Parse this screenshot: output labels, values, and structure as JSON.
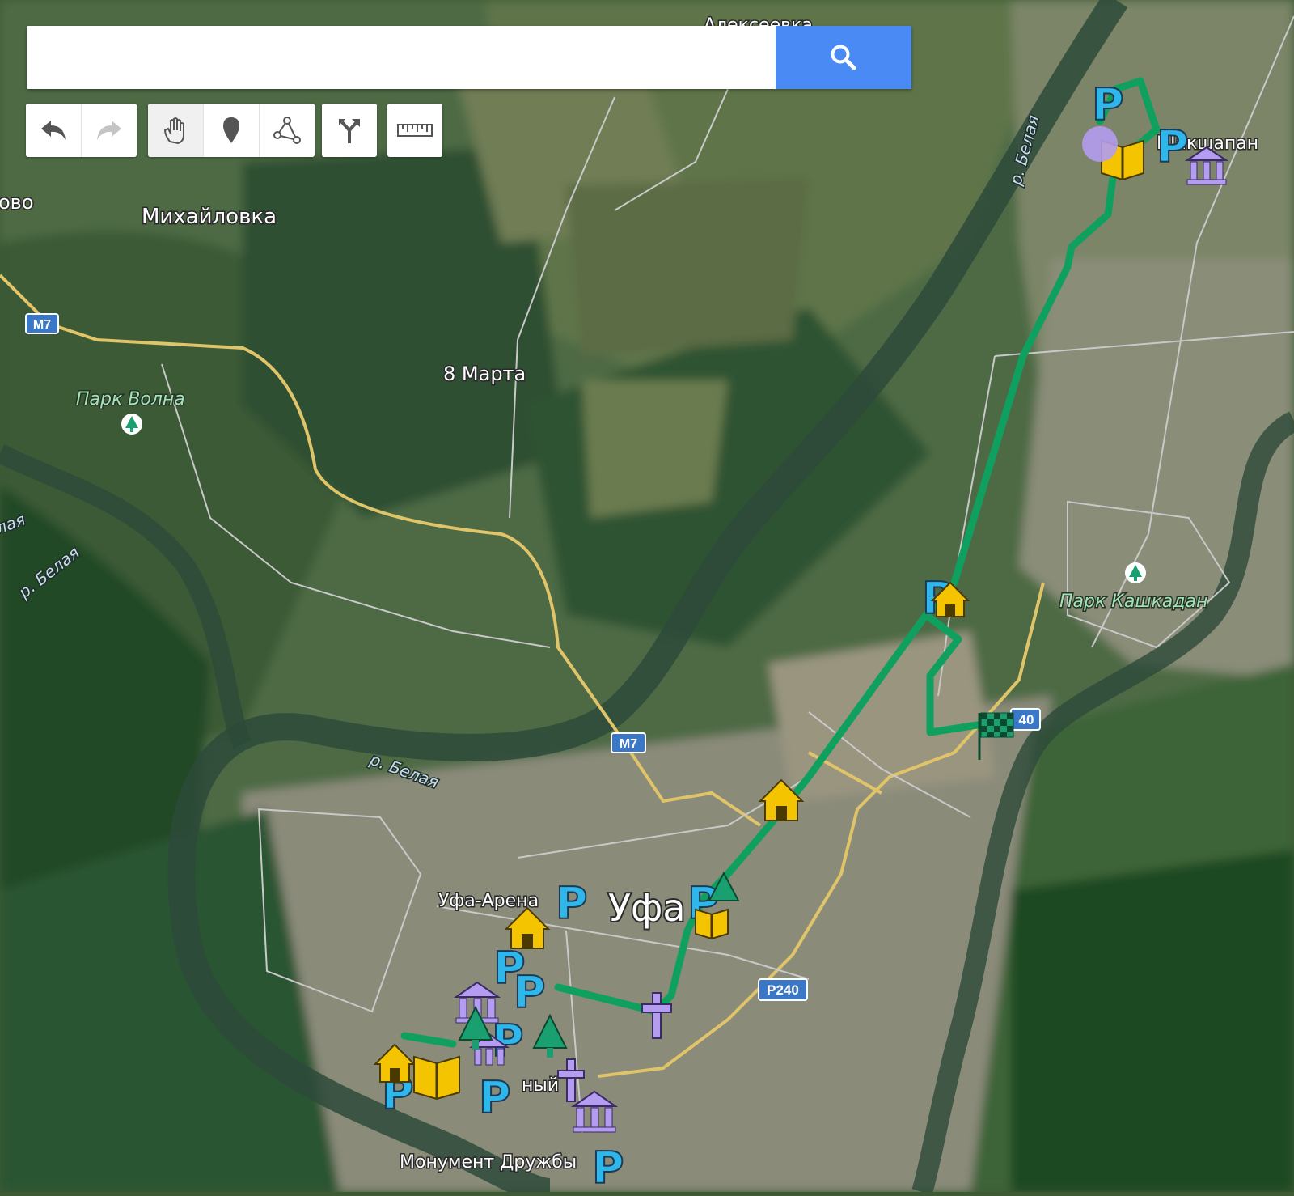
{
  "search": {
    "placeholder": "",
    "value": ""
  },
  "toolbar": {
    "undo": "undo-icon",
    "redo": "redo-icon",
    "pan": "hand-icon",
    "marker": "marker-icon",
    "line": "draw-line-icon",
    "directions": "directions-icon",
    "measure": "ruler-icon"
  },
  "colors": {
    "route": "#0fa060",
    "search_button": "#4a8af4",
    "parking": "#2fb6ea",
    "house": "#f5c400",
    "poi_purple": "#b49cf0",
    "park_green": "#1aa070"
  },
  "labels": {
    "mikhailovka": "Михайловка",
    "march8": "8 Марта",
    "park_volna": "Парк Волна",
    "belaya_1": "р. Белая",
    "belaya_2": "р. Белая",
    "belaya_3": "р. Белая",
    "belaya_4": "р. Белая",
    "belaya_5": "лая",
    "park_kashkadan": "Парк Кашкадан",
    "ufa": "Уфа",
    "ufa_arena": "Уфа-Арена",
    "monument": "Монумент Дружбы",
    "shakshа": "Шакшапан",
    "yny": "ный",
    "ovo": "ово",
    "top_fragment": "Алексеевка",
    "m7_1": "M7",
    "m7_2": "M7",
    "r240": "P240",
    "r240_cut": "40"
  }
}
